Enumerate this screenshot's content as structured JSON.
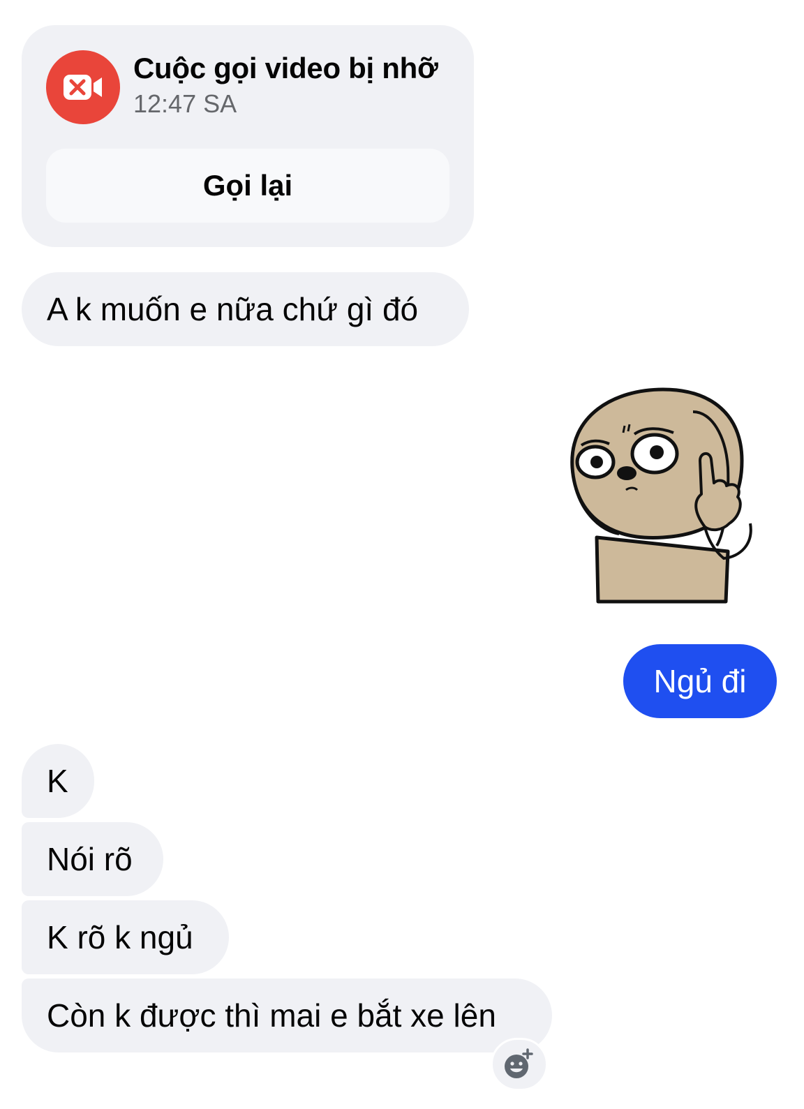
{
  "call_card": {
    "title": "Cuộc gọi video bị nhỡ",
    "time": "12:47 SA",
    "button_label": "Gọi lại",
    "icon": "missed-video-call-icon",
    "icon_color": "#e9453a"
  },
  "messages": [
    {
      "sender": "other",
      "text": "A k muốn e nữa chứ gì đó"
    },
    {
      "sender": "self",
      "type": "sticker",
      "sticker": "sticker-character-pointing-up"
    },
    {
      "sender": "self",
      "text": "Ngủ đi"
    },
    {
      "sender": "other",
      "text": "K"
    },
    {
      "sender": "other",
      "text": "Nói rõ"
    },
    {
      "sender": "other",
      "text": "K rõ k ngủ"
    },
    {
      "sender": "other",
      "text": "Còn k được thì mai e bắt xe lên"
    }
  ],
  "reaction_button": {
    "icon": "add-reaction-icon"
  },
  "colors": {
    "sent_bubble": "#1f4ff0",
    "received_bubble": "#f0f1f5",
    "text_primary": "#050505",
    "text_secondary": "#65676b"
  }
}
